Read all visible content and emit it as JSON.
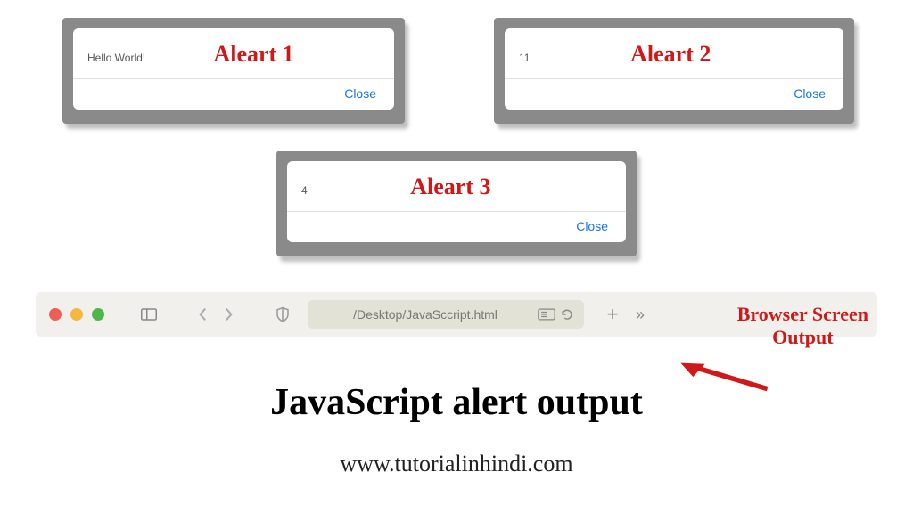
{
  "alerts": {
    "a1": {
      "message": "Hello World!",
      "label": "Aleart 1",
      "close": "Close"
    },
    "a2": {
      "message": "11",
      "label": "Aleart 2",
      "close": "Close"
    },
    "a3": {
      "message": "4",
      "label": "Aleart 3",
      "close": "Close"
    }
  },
  "browser": {
    "url": "/Desktop/JavaSccript.html"
  },
  "output": {
    "heading": "JavaScript alert output",
    "site": "www.tutorialinhindi.com"
  },
  "annotation": {
    "line1": "Browser Screen",
    "line2": "Output"
  }
}
